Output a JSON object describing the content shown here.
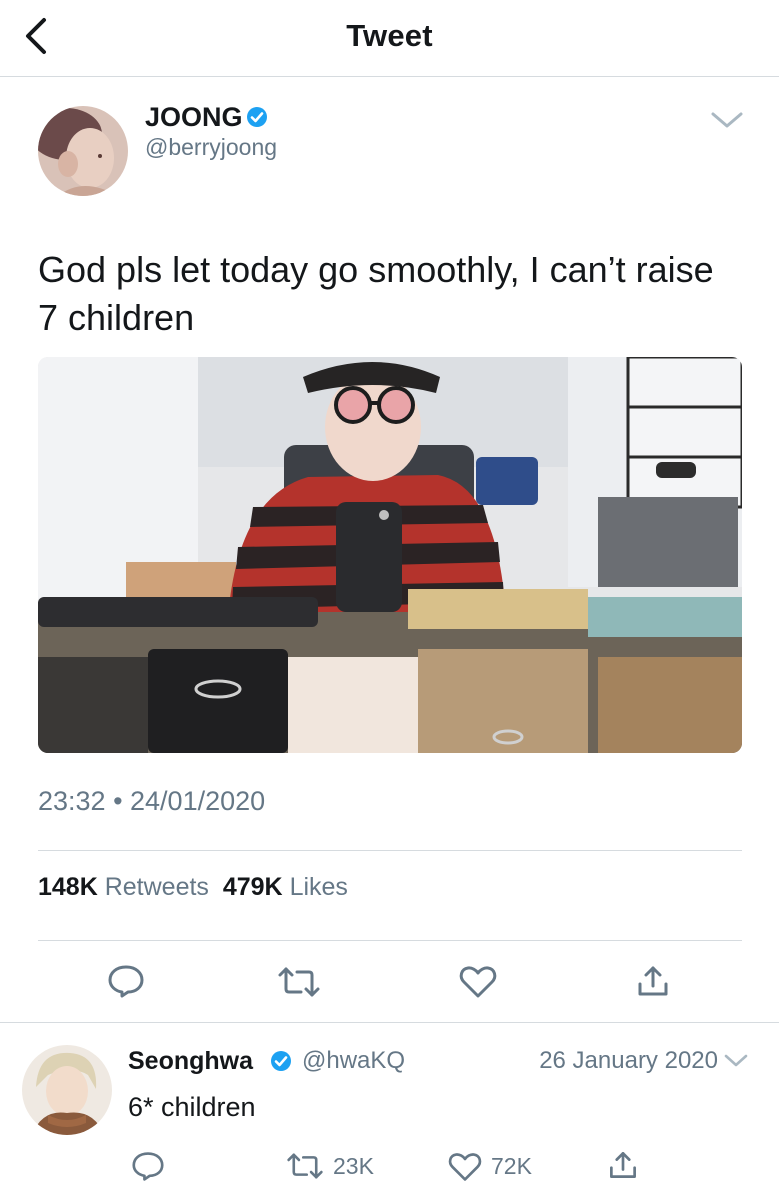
{
  "header": {
    "title": "Tweet",
    "back_icon": "chevron-left-icon"
  },
  "tweet": {
    "author": {
      "name": "JOONG",
      "handle": "@berryjoong",
      "verified": true
    },
    "text": "God pls let today go smoothly, I can’t raise 7 children",
    "timestamp": "23:32 • 24/01/2020",
    "stats": {
      "retweets_count": "148K",
      "retweets_label": "Retweets",
      "likes_count": "479K",
      "likes_label": "Likes"
    },
    "actions": [
      "reply-icon",
      "retweet-icon",
      "like-icon",
      "share-icon"
    ]
  },
  "reply": {
    "author": {
      "name": "Seonghwa",
      "handle": "@hwaKQ",
      "verified": true
    },
    "date": "26 January 2020",
    "text": "6* children",
    "retweet_count": "23K",
    "like_count": "72K"
  },
  "colors": {
    "verified": "#1da1f2",
    "secondary_text": "#657786",
    "divider": "#d6dbdf",
    "action_icon": "#657786"
  }
}
